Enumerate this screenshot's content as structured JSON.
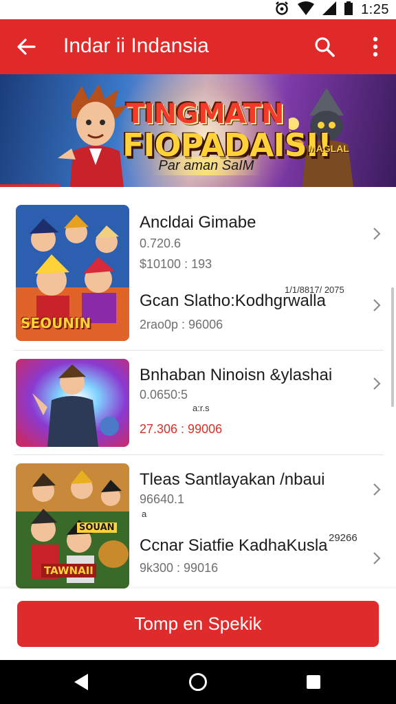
{
  "status_bar": {
    "time": "1:25",
    "icons": [
      "alarm-icon",
      "wifi-icon",
      "signal-icon",
      "battery-icon"
    ]
  },
  "app_bar": {
    "title": "Indar ii Indansia",
    "back_icon": "arrow-back-icon",
    "search_icon": "search-icon",
    "more_icon": "more-vert-icon",
    "color": "#e02a2a"
  },
  "banner": {
    "headline_line1": "TINGMATN",
    "headline_line2": "FIOPADAISI!",
    "subtitle": "Par aman SaIM",
    "tag": "MAGLAL"
  },
  "list": {
    "items": [
      {
        "title": "Ancldai Gimabe",
        "meta1": "0.720.6",
        "meta2": "$10100 : 193",
        "title2": "Gcan Slatho:Kodhgrwalla",
        "tag": "1/1/8817/ 2075",
        "meta3": "2rao0p : 96006",
        "image_label": "SEOUNIN"
      },
      {
        "title": "Bnhaban Ninoisn &ylashai",
        "meta1": "0.0650:5",
        "tag": "a:r.s",
        "meta2": "27.306 : 99006"
      },
      {
        "title": "Tleas Santlayakan /nbaui",
        "meta1": "96640.1",
        "tag": "a",
        "title2": "Ccnar Siatfie KadhaKusla",
        "tag2": "29266",
        "meta2": "9k300 : 99016",
        "image_label": "SOUAN",
        "image_label2": "TAWNAII"
      }
    ]
  },
  "cta": {
    "label": "Tomp en Spekik",
    "color": "#df2b2b"
  },
  "nav_bar": {
    "icons": [
      "back-triangle-icon",
      "home-circle-icon",
      "recents-square-icon"
    ]
  }
}
